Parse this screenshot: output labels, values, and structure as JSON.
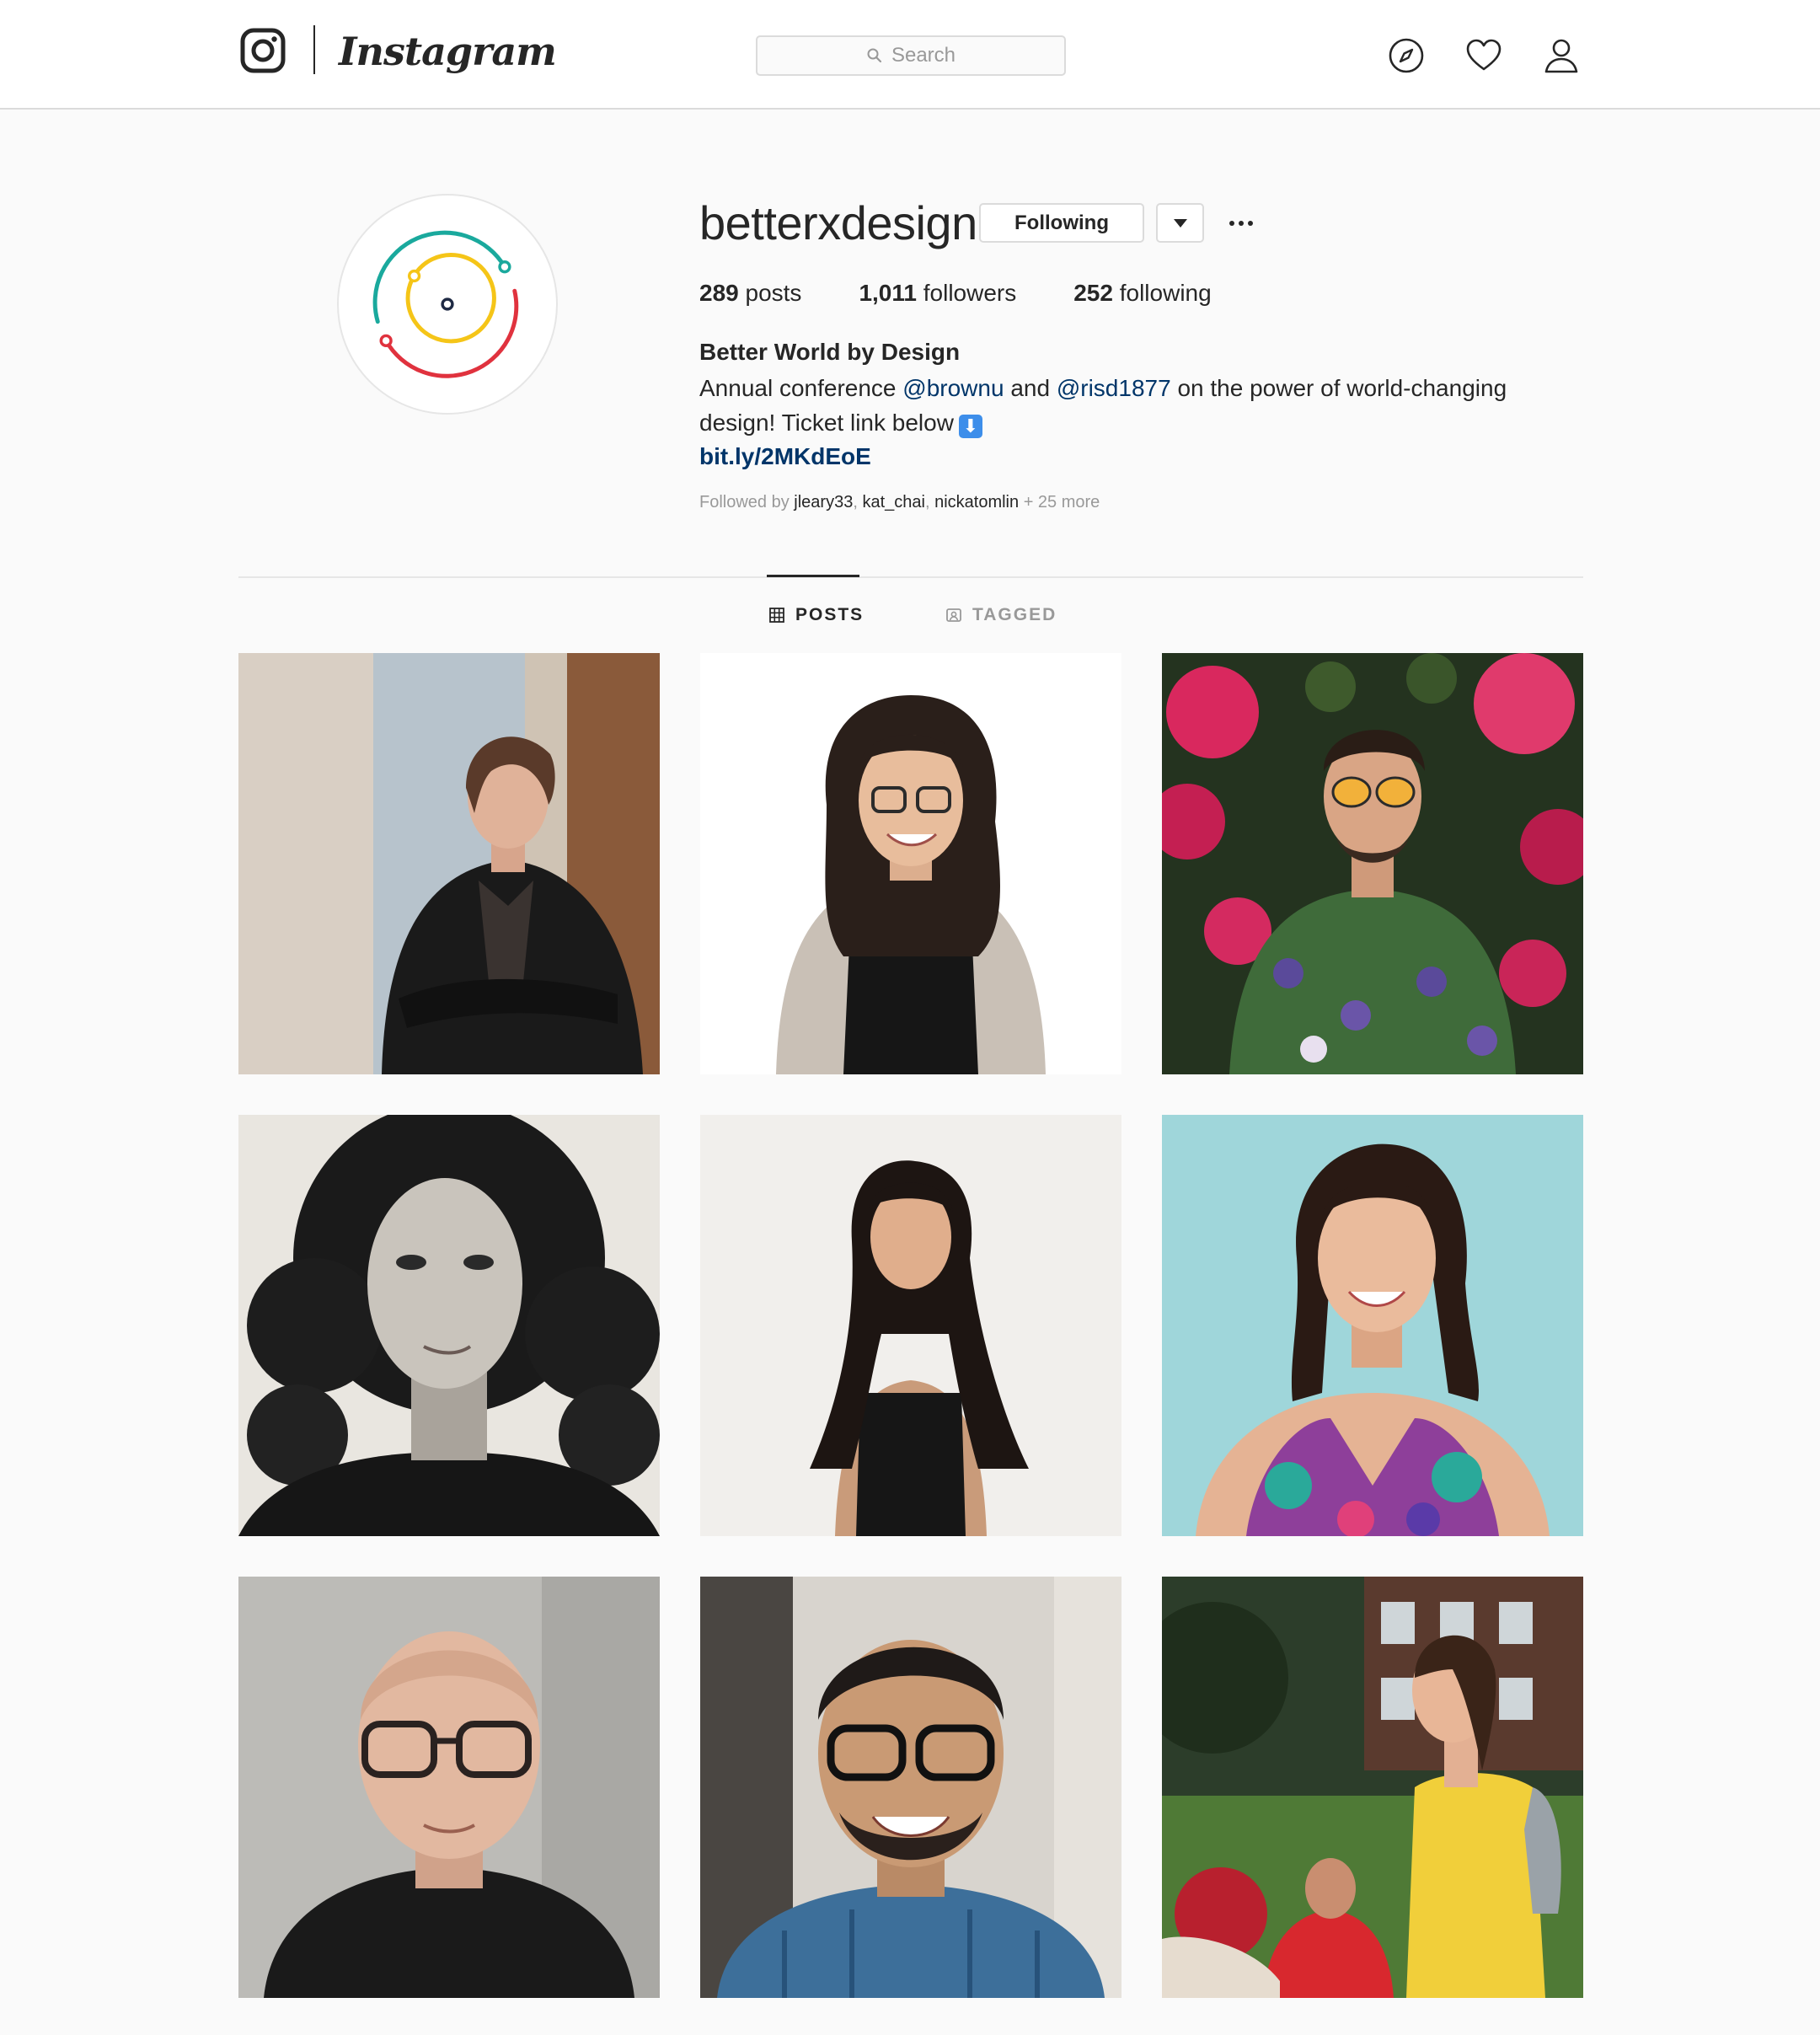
{
  "nav": {
    "wordmark": "Instagram",
    "search_placeholder": "Search",
    "icons": [
      "instagram-glyph-icon",
      "search-icon",
      "compass-icon",
      "heart-icon",
      "user-icon"
    ]
  },
  "profile": {
    "username": "betterxdesign",
    "following_label": "Following",
    "stats": {
      "posts_count": "289",
      "posts_label": "posts",
      "followers_count": "1,011",
      "followers_label": "followers",
      "following_count": "252",
      "following_label": "following"
    },
    "full_name": "Better World by Design",
    "bio": {
      "part1": "Annual conference ",
      "mention1": "@brownu",
      "part2": " and ",
      "mention2": "@risd1877",
      "part3": " on the power of world-changing design! Ticket link below",
      "emoji": "⬇"
    },
    "link": "bit.ly/2MKdEoE",
    "followed_by": {
      "prefix": "Followed by",
      "users": [
        "jleary33",
        "kat_chai",
        "nickatomlin"
      ],
      "more": "+ 25 more"
    }
  },
  "tabs": [
    {
      "label": "POSTS",
      "active": true
    },
    {
      "label": "TAGGED",
      "active": false
    }
  ],
  "colors": {
    "logo_teal": "#1aa99d",
    "logo_yellow": "#f5c518",
    "logo_red": "#e0323e",
    "logo_navy": "#1f2a44",
    "link": "#003569"
  },
  "posts_count_visible": 9
}
